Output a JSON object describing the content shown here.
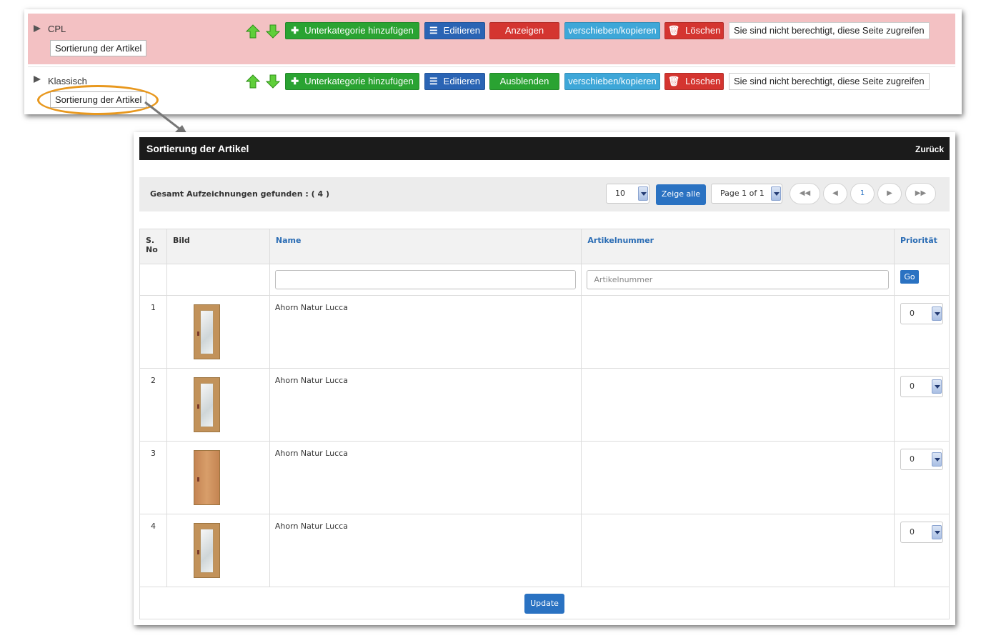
{
  "categories": [
    {
      "name": "CPL",
      "sort_label": "Sortierung der Artikel",
      "add_sub_label": "Unterkategorie hinzufügen",
      "edit_label": "Editieren",
      "toggle_label": "Anzeigen",
      "move_label": "verschieben/kopieren",
      "delete_label": "Löschen",
      "notice": "Sie sind nicht berechtigt, diese Seite zugreifen"
    },
    {
      "name": "Klassisch",
      "sort_label": "Sortierung der Artikel",
      "add_sub_label": "Unterkategorie hinzufügen",
      "edit_label": "Editieren",
      "toggle_label": "Ausblenden",
      "move_label": "verschieben/kopieren",
      "delete_label": "Löschen",
      "notice": "Sie sind nicht berechtigt, diese Seite zugreifen"
    }
  ],
  "sorting_panel": {
    "title": "Sortierung der Artikel",
    "back_label": "Zurück",
    "records_label": "Gesamt Aufzeichnungen gefunden : ( 4 )",
    "page_size": "10",
    "show_all_label": "Zeige alle",
    "page_select": "Page 1 of 1",
    "pager": {
      "first": "◀◀",
      "prev": "◀",
      "current": "1",
      "next": "▶",
      "last": "▶▶"
    },
    "columns": {
      "sno": "S. No",
      "image": "Bild",
      "name": "Name",
      "article_no": "Artikelnummer",
      "priority": "Priorität"
    },
    "filter": {
      "name_value": "",
      "article_no_placeholder": "Artikelnummer",
      "go_label": "Go"
    },
    "rows": [
      {
        "sno": "1",
        "name": "Ahorn Natur Lucca",
        "article_no": "",
        "priority": "0",
        "image": "door-glass-icon"
      },
      {
        "sno": "2",
        "name": "Ahorn Natur Lucca",
        "article_no": "",
        "priority": "0",
        "image": "door-glass-icon"
      },
      {
        "sno": "3",
        "name": "Ahorn Natur Lucca",
        "article_no": "",
        "priority": "0",
        "image": "door-plain-icon"
      },
      {
        "sno": "4",
        "name": "Ahorn Natur Lucca",
        "article_no": "",
        "priority": "0",
        "image": "door-glass-icon"
      }
    ],
    "update_label": "Update"
  },
  "colors": {
    "hidden_row_bg": "#f3c1c3",
    "green": "#2aa332",
    "blue": "#2a64b4",
    "red": "#d43530",
    "cyan": "#3ea7d8",
    "highlight": "#e8981e"
  }
}
